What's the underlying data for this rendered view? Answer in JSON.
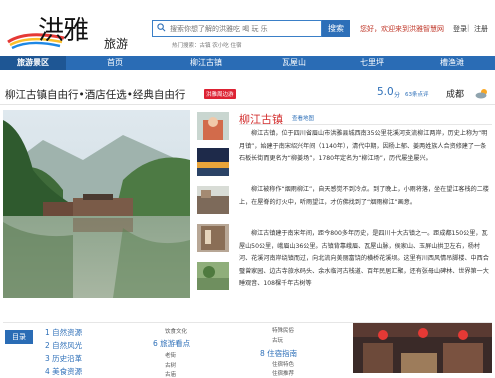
{
  "header": {
    "logo_text": "洪雅",
    "logo_section": "旅游",
    "search_placeholder": "搜索你想了解的洪雅吃 喝 玩 乐",
    "search_button": "搜索",
    "hot_label": "热门搜索：古镇 农小吃 住宿",
    "welcome": "您好，欢迎来到洪雅智慧网",
    "login": "登录",
    "register": "注册",
    "sep": "|"
  },
  "nav": {
    "items": [
      "旅游景区",
      "首页",
      "柳江古镇",
      "瓦屋山",
      "七里坪",
      "槽渔滩"
    ]
  },
  "title_row": {
    "title": "柳江古镇自由行•酒店任选•经典自由行",
    "badge": "洪雅周边游",
    "score": "5.0",
    "score_unit": "分",
    "reviews": "63条点评",
    "city": "成都"
  },
  "article": {
    "title": "柳江古镇",
    "link": "查看地图",
    "paragraphs": [
      "柳江古镇，位于四川省眉山市洪雅县城西南35公里花溪河支流柳江两岸，历史上称为“明月镇”，始建于南宋绍兴年间（1140年），清代中期，因杨上郁、姜两姓族人合资修建了一条石板长街而更名为“柳姜场”，1780年定名为“柳江场”，历代屡坐屡兴。",
      "柳江被称作“烟雨柳江”，自天感觉不到冷点。到了晚上，小雨将落，坐在望江客栈的二楼上，在屋脊的灯火中，听雨望江，才仿佛找到了“烟雨柳江”画意。",
      "柳江古镇建于南宋年间，距今800多年历史，是四川十大古镇之一。距成都150公里，瓦屋山50公里，峨眉山36公里。古镇背靠峨眉、瓦屋山脉，侯家山、玉屏山拱卫左右，杨村河、花溪河南岸绕镇而过，向北流向美丽富饶的横桥花溪坝。这里有川西风情吊脚楼、中西合璧曾家园、边古寺旅水码头、余水临河古栈道、百年民居汇聚，还有张母山碑林、世界第一大睡观音、108棵千年古树等"
    ]
  },
  "toc": {
    "label": "目录",
    "col1": [
      "1 自然资源",
      "2 自然风光",
      "3 历史沿革",
      "4 美食资源"
    ],
    "col2_top": "饮食文化",
    "col2_main": "6 旅游看点",
    "col2_subs": [
      "老街",
      "古树",
      "古庙"
    ],
    "col3_subs_top": [
      "特殊民俗",
      "古玩"
    ],
    "col3_main": "8 住宿指南",
    "col3_subs": [
      "住宿特色",
      "住宿推荐"
    ]
  },
  "colors": {
    "brand_blue": "#2a6cb5",
    "accent_red": "#d32f2f"
  }
}
